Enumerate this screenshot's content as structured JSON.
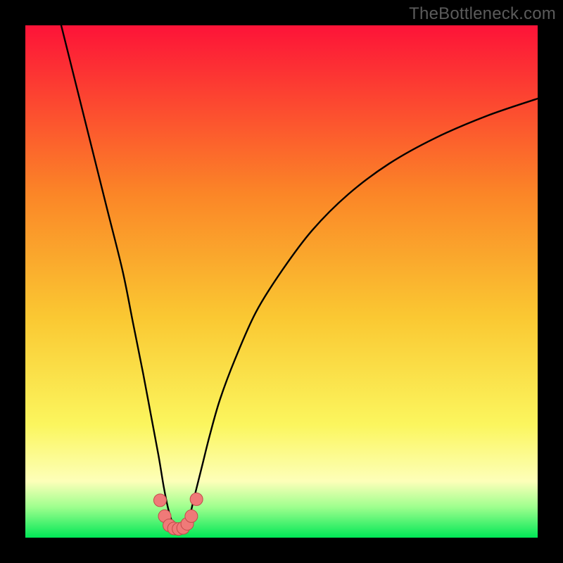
{
  "watermark": "TheBottleneck.com",
  "colors": {
    "background": "#000000",
    "gradient_top": "#fd1338",
    "gradient_mid_upper": "#fb8627",
    "gradient_mid": "#fac832",
    "gradient_mid_lower": "#fbf65e",
    "gradient_band": "#fdffb9",
    "gradient_green_top": "#9fff8e",
    "gradient_green": "#00e756",
    "curve_stroke": "#000000",
    "marker_fill": "#ef7a78",
    "marker_stroke": "#c24b4a"
  },
  "chart_data": {
    "type": "line",
    "title": "",
    "xlabel": "",
    "ylabel": "",
    "xlim": [
      0,
      100
    ],
    "ylim": [
      0,
      100
    ],
    "series": [
      {
        "name": "bottleneck-curve",
        "x": [
          7,
          10,
          13,
          16,
          19,
          21,
          23,
          24.5,
          26,
          27,
          27.8,
          28.5,
          29,
          29.5,
          30,
          30.5,
          31,
          32,
          33,
          34.5,
          36,
          38,
          41,
          45,
          50,
          56,
          63,
          71,
          80,
          90,
          100
        ],
        "y": [
          100,
          88,
          76,
          64,
          52,
          42,
          32,
          24,
          16,
          10,
          6,
          3.5,
          2.2,
          1.7,
          1.6,
          1.7,
          2.2,
          4,
          8,
          14,
          20,
          27,
          35,
          44,
          52,
          60,
          67,
          73,
          78,
          82.3,
          85.7
        ]
      }
    ],
    "markers": {
      "name": "highlight-dots",
      "points": [
        {
          "x": 26.3,
          "y": 7.3
        },
        {
          "x": 27.2,
          "y": 4.2
        },
        {
          "x": 28.1,
          "y": 2.4
        },
        {
          "x": 29.0,
          "y": 1.8
        },
        {
          "x": 29.9,
          "y": 1.7
        },
        {
          "x": 30.8,
          "y": 1.9
        },
        {
          "x": 31.6,
          "y": 2.7
        },
        {
          "x": 32.4,
          "y": 4.2
        },
        {
          "x": 33.4,
          "y": 7.5
        }
      ]
    }
  }
}
